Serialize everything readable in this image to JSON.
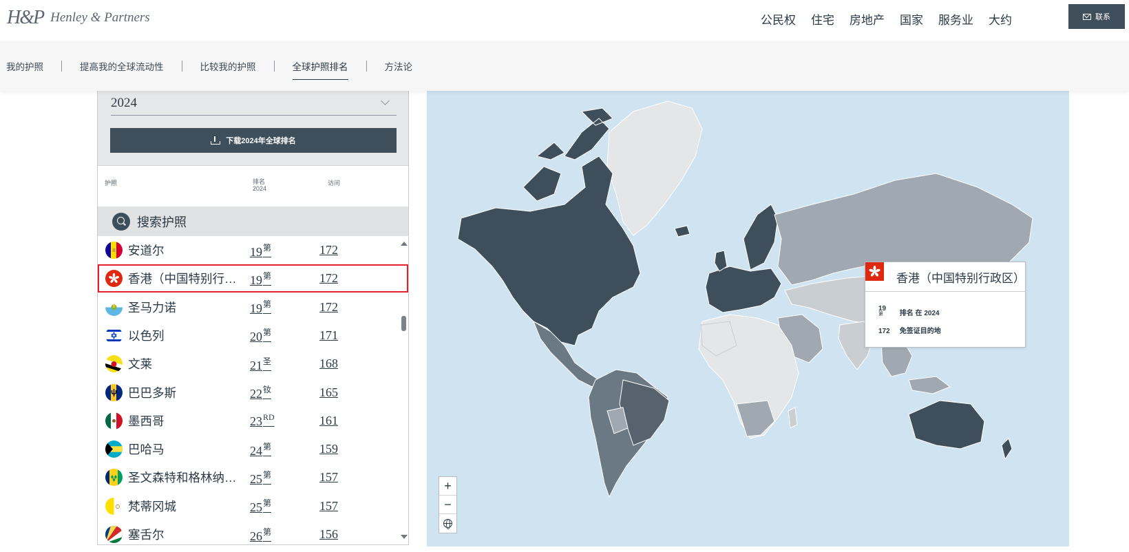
{
  "header": {
    "logo_mark": "H&P",
    "logo_text": "Henley & Partners",
    "nav": [
      "公民权",
      "住宅",
      "房地产",
      "国家",
      "服务业",
      "大约"
    ],
    "contact_label": "联系"
  },
  "subnav": {
    "items": [
      "我的护照",
      "提高我的全球流动性",
      "比较我的护照",
      "全球护照排名",
      "方法论"
    ],
    "active_index": 3
  },
  "panel": {
    "year": "2024",
    "download_label": "下载2024年全球排名",
    "columns": {
      "passport": "护照",
      "rank": "排名",
      "rank_year": "2024",
      "visa": "访问"
    },
    "search_label": "搜索护照",
    "rows": [
      {
        "name": "安道尔",
        "rank": "19",
        "suffix": "第",
        "visa": "172",
        "flag": "andorra"
      },
      {
        "name": "香港（中国特别行政区）",
        "rank": "19",
        "suffix": "第",
        "visa": "172",
        "flag": "hongkong",
        "highlighted": true
      },
      {
        "name": "圣马力诺",
        "rank": "19",
        "suffix": "第",
        "visa": "172",
        "flag": "sanmarino"
      },
      {
        "name": "以色列",
        "rank": "20",
        "suffix": "第",
        "visa": "171",
        "flag": "israel"
      },
      {
        "name": "文莱",
        "rank": "21",
        "suffix": "圣",
        "visa": "168",
        "flag": "brunei"
      },
      {
        "name": "巴巴多斯",
        "rank": "22",
        "suffix": "钕",
        "visa": "165",
        "flag": "barbados"
      },
      {
        "name": "墨西哥",
        "rank": "23",
        "suffix": "RD",
        "visa": "161",
        "flag": "mexico"
      },
      {
        "name": "巴哈马",
        "rank": "24",
        "suffix": "第",
        "visa": "159",
        "flag": "bahamas"
      },
      {
        "name": "圣文森特和格林纳丁斯",
        "rank": "25",
        "suffix": "第",
        "visa": "157",
        "flag": "stvincent"
      },
      {
        "name": "梵蒂冈城",
        "rank": "25",
        "suffix": "第",
        "visa": "157",
        "flag": "vatican"
      },
      {
        "name": "塞舌尔",
        "rank": "26",
        "suffix": "第",
        "visa": "156",
        "flag": "seychelles"
      }
    ]
  },
  "map": {
    "tooltip": {
      "country": "香港（中国特别行政区）",
      "rank": "19",
      "rank_suffix": "第",
      "rank_label": "排名 在 2024",
      "visa": "172",
      "visa_label": "免签证目的地"
    },
    "zoom_in": "+",
    "zoom_out": "−",
    "colors": {
      "ocean": "#cfe3f1",
      "dark": "#3f4e5b",
      "mid": "#6b7985",
      "light": "#a0a9b1",
      "lighter": "#c9ced3",
      "pale": "#e4e6e8"
    }
  }
}
